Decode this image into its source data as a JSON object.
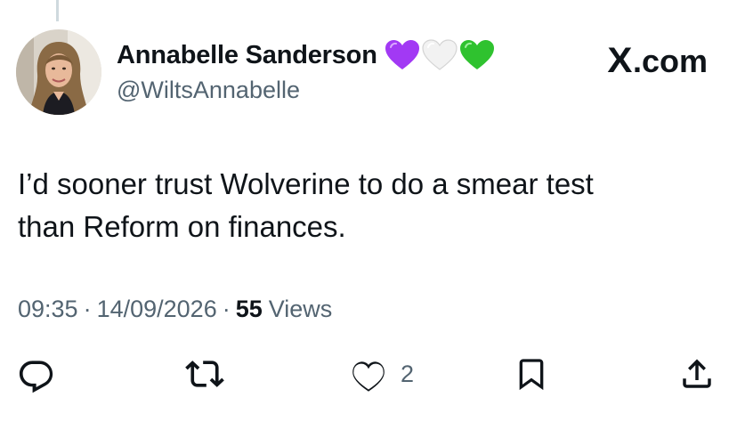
{
  "author": {
    "name": "Annabelle Sanderson",
    "handle": "@WiltsAnnabelle",
    "badges": [
      "purple-heart-icon",
      "white-heart-icon",
      "green-heart-icon"
    ]
  },
  "brand": {
    "logo_letter": "X",
    "suffix": ".com"
  },
  "tweet": {
    "lines": [
      "I’d sooner trust Wolverine to do a smear test",
      "than Reform on finances."
    ]
  },
  "meta": {
    "time": "09:35",
    "date": "14/09/2026",
    "separator": "·",
    "views_count": "55",
    "views_label": "Views"
  },
  "actions": {
    "icons": [
      "reply-icon",
      "retweet-icon",
      "like-icon",
      "bookmark-icon",
      "share-icon"
    ],
    "like_count": "2"
  },
  "colors": {
    "text": "#0f1419",
    "muted": "#536471",
    "purple_heart": "#a239f4",
    "white_heart": "#efefef",
    "green_heart": "#2fc22f"
  }
}
